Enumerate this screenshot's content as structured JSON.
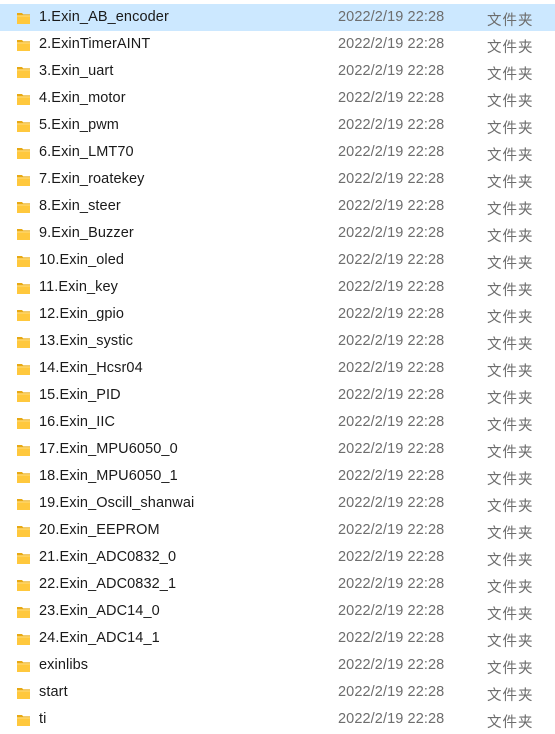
{
  "file_list": {
    "items": [
      {
        "name": "1.Exin_AB_encoder",
        "modified": "2022/2/19 22:28",
        "type": "文件夹",
        "icon": "folder-icon",
        "selected": true
      },
      {
        "name": "2.ExinTimerAINT",
        "modified": "2022/2/19 22:28",
        "type": "文件夹",
        "icon": "folder-icon"
      },
      {
        "name": "3.Exin_uart",
        "modified": "2022/2/19 22:28",
        "type": "文件夹",
        "icon": "folder-icon"
      },
      {
        "name": "4.Exin_motor",
        "modified": "2022/2/19 22:28",
        "type": "文件夹",
        "icon": "folder-icon"
      },
      {
        "name": "5.Exin_pwm",
        "modified": "2022/2/19 22:28",
        "type": "文件夹",
        "icon": "folder-icon"
      },
      {
        "name": "6.Exin_LMT70",
        "modified": "2022/2/19 22:28",
        "type": "文件夹",
        "icon": "folder-icon"
      },
      {
        "name": "7.Exin_roatekey",
        "modified": "2022/2/19 22:28",
        "type": "文件夹",
        "icon": "folder-icon"
      },
      {
        "name": "8.Exin_steer",
        "modified": "2022/2/19 22:28",
        "type": "文件夹",
        "icon": "folder-icon"
      },
      {
        "name": "9.Exin_Buzzer",
        "modified": "2022/2/19 22:28",
        "type": "文件夹",
        "icon": "folder-icon"
      },
      {
        "name": "10.Exin_oled",
        "modified": "2022/2/19 22:28",
        "type": "文件夹",
        "icon": "folder-icon"
      },
      {
        "name": "11.Exin_key",
        "modified": "2022/2/19 22:28",
        "type": "文件夹",
        "icon": "folder-icon"
      },
      {
        "name": "12.Exin_gpio",
        "modified": "2022/2/19 22:28",
        "type": "文件夹",
        "icon": "folder-icon"
      },
      {
        "name": "13.Exin_systic",
        "modified": "2022/2/19 22:28",
        "type": "文件夹",
        "icon": "folder-icon"
      },
      {
        "name": "14.Exin_Hcsr04",
        "modified": "2022/2/19 22:28",
        "type": "文件夹",
        "icon": "folder-icon"
      },
      {
        "name": "15.Exin_PID",
        "modified": "2022/2/19 22:28",
        "type": "文件夹",
        "icon": "folder-icon"
      },
      {
        "name": "16.Exin_IIC",
        "modified": "2022/2/19 22:28",
        "type": "文件夹",
        "icon": "folder-icon"
      },
      {
        "name": "17.Exin_MPU6050_0",
        "modified": "2022/2/19 22:28",
        "type": "文件夹",
        "icon": "folder-icon"
      },
      {
        "name": "18.Exin_MPU6050_1",
        "modified": "2022/2/19 22:28",
        "type": "文件夹",
        "icon": "folder-icon"
      },
      {
        "name": "19.Exin_Oscill_shanwai",
        "modified": "2022/2/19 22:28",
        "type": "文件夹",
        "icon": "folder-icon"
      },
      {
        "name": "20.Exin_EEPROM",
        "modified": "2022/2/19 22:28",
        "type": "文件夹",
        "icon": "folder-icon"
      },
      {
        "name": "21.Exin_ADC0832_0",
        "modified": "2022/2/19 22:28",
        "type": "文件夹",
        "icon": "folder-icon"
      },
      {
        "name": "22.Exin_ADC0832_1",
        "modified": "2022/2/19 22:28",
        "type": "文件夹",
        "icon": "folder-icon"
      },
      {
        "name": "23.Exin_ADC14_0",
        "modified": "2022/2/19 22:28",
        "type": "文件夹",
        "icon": "folder-icon"
      },
      {
        "name": "24.Exin_ADC14_1",
        "modified": "2022/2/19 22:28",
        "type": "文件夹",
        "icon": "folder-icon"
      },
      {
        "name": "exinlibs",
        "modified": "2022/2/19 22:28",
        "type": "文件夹",
        "icon": "folder-icon"
      },
      {
        "name": "start",
        "modified": "2022/2/19 22:28",
        "type": "文件夹",
        "icon": "folder-icon"
      },
      {
        "name": "ti",
        "modified": "2022/2/19 22:28",
        "type": "文件夹",
        "icon": "folder-icon"
      }
    ]
  },
  "colors": {
    "selection_background": "#cce8ff",
    "folder_body": "#ffc83d",
    "folder_tab": "#e8a913",
    "secondary_text": "#6d6d6d"
  }
}
